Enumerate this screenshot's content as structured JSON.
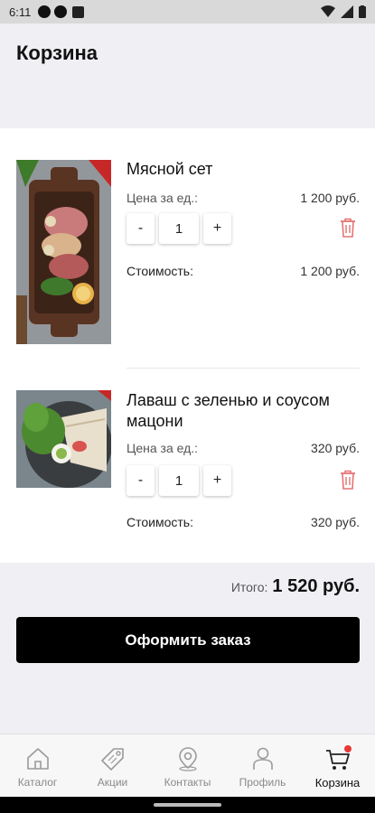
{
  "status_bar": {
    "time": "6:11"
  },
  "header": {
    "title": "Корзина"
  },
  "cart": {
    "items": [
      {
        "name": "Мясной сет",
        "unit_price_label": "Цена за ед.:",
        "unit_price": "1 200 руб.",
        "quantity": "1",
        "cost_label": "Стоимость:",
        "cost": "1 200 руб.",
        "minus": "-",
        "plus": "+"
      },
      {
        "name": "Лаваш с зеленью и соусом мацони",
        "unit_price_label": "Цена за ед.:",
        "unit_price": "320 руб.",
        "quantity": "1",
        "cost_label": "Стоимость:",
        "cost": "320 руб.",
        "minus": "-",
        "plus": "+"
      }
    ]
  },
  "total": {
    "label": "Итого:",
    "value": "1 520 руб."
  },
  "checkout": {
    "label": "Оформить заказ"
  },
  "nav": {
    "items": [
      {
        "label": "Каталог",
        "icon": "home-icon"
      },
      {
        "label": "Акции",
        "icon": "tag-icon"
      },
      {
        "label": "Контакты",
        "icon": "location-pin-icon"
      },
      {
        "label": "Профиль",
        "icon": "user-icon"
      },
      {
        "label": "Корзина",
        "icon": "cart-icon"
      }
    ]
  },
  "colors": {
    "accent": "#000000",
    "trash": "#e57373",
    "badge": "#e53935"
  }
}
